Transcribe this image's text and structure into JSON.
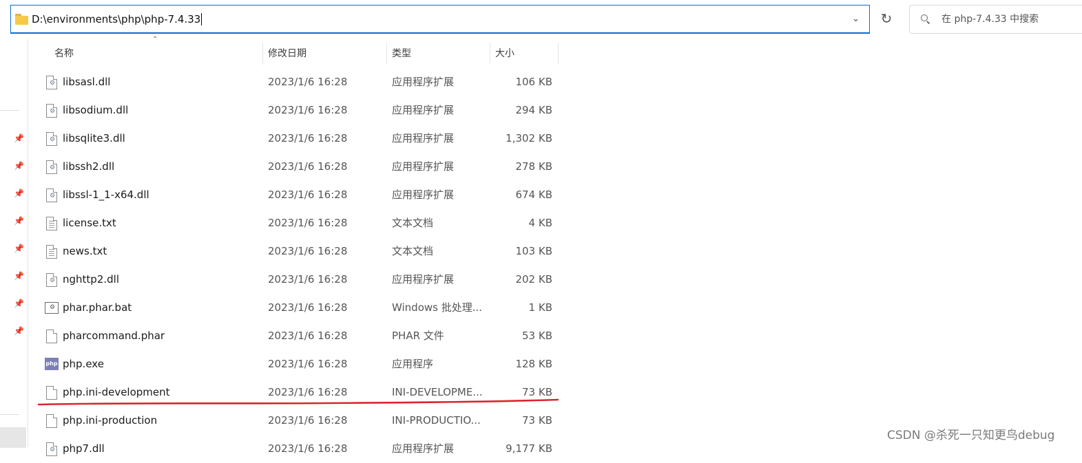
{
  "address_bar": {
    "path": "D:\\environments\\php\\php-7.4.33",
    "folder_icon": "folder-icon",
    "dropdown_icon": "chevron-down-icon"
  },
  "refresh_icon": "refresh-icon",
  "search": {
    "placeholder": "在 php-7.4.33 中搜索",
    "icon": "search-icon"
  },
  "columns": {
    "name": "名称",
    "date": "修改日期",
    "type": "类型",
    "size": "大小"
  },
  "files": [
    {
      "name": "libsasl.dll",
      "date": "2023/1/6 16:28",
      "type": "应用程序扩展",
      "size": "106 KB",
      "icon": "dll-file-icon"
    },
    {
      "name": "libsodium.dll",
      "date": "2023/1/6 16:28",
      "type": "应用程序扩展",
      "size": "294 KB",
      "icon": "dll-file-icon"
    },
    {
      "name": "libsqlite3.dll",
      "date": "2023/1/6 16:28",
      "type": "应用程序扩展",
      "size": "1,302 KB",
      "icon": "dll-file-icon"
    },
    {
      "name": "libssh2.dll",
      "date": "2023/1/6 16:28",
      "type": "应用程序扩展",
      "size": "278 KB",
      "icon": "dll-file-icon"
    },
    {
      "name": "libssl-1_1-x64.dll",
      "date": "2023/1/6 16:28",
      "type": "应用程序扩展",
      "size": "674 KB",
      "icon": "dll-file-icon"
    },
    {
      "name": "license.txt",
      "date": "2023/1/6 16:28",
      "type": "文本文档",
      "size": "4 KB",
      "icon": "text-file-icon"
    },
    {
      "name": "news.txt",
      "date": "2023/1/6 16:28",
      "type": "文本文档",
      "size": "103 KB",
      "icon": "text-file-icon"
    },
    {
      "name": "nghttp2.dll",
      "date": "2023/1/6 16:28",
      "type": "应用程序扩展",
      "size": "202 KB",
      "icon": "dll-file-icon"
    },
    {
      "name": "phar.phar.bat",
      "date": "2023/1/6 16:28",
      "type": "Windows 批处理...",
      "size": "1 KB",
      "icon": "batch-file-icon"
    },
    {
      "name": "pharcommand.phar",
      "date": "2023/1/6 16:28",
      "type": "PHAR 文件",
      "size": "53 KB",
      "icon": "blank-file-icon"
    },
    {
      "name": "php.exe",
      "date": "2023/1/6 16:28",
      "type": "应用程序",
      "size": "128 KB",
      "icon": "php-exe-icon",
      "icon_text": "php"
    },
    {
      "name": "php.ini-development",
      "date": "2023/1/6 16:28",
      "type": "INI-DEVELOPME...",
      "size": "73 KB",
      "icon": "blank-file-icon"
    },
    {
      "name": "php.ini-production",
      "date": "2023/1/6 16:28",
      "type": "INI-PRODUCTIO...",
      "size": "73 KB",
      "icon": "blank-file-icon"
    },
    {
      "name": "php7.dll",
      "date": "2023/1/6 16:28",
      "type": "应用程序扩展",
      "size": "9,177 KB",
      "icon": "dll-file-icon"
    }
  ],
  "annotation": {
    "color": "#d9262c"
  },
  "watermark": "CSDN @杀死一只知更鸟debug"
}
